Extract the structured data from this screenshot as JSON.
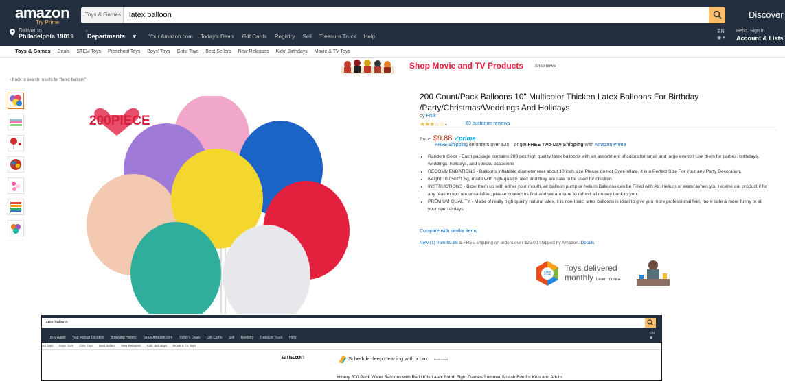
{
  "header": {
    "logo": "amazon",
    "logo_sub": "Try Prime",
    "search_category": "Toys & Games",
    "search_query": "latex balloon",
    "discover": "Discover s",
    "deliver_label": "Deliver to",
    "deliver_location": "Philadelphia 19019",
    "departments": "Departments",
    "nav": [
      "Your Amazon.com",
      "Today's Deals",
      "Gift Cards",
      "Registry",
      "Sell",
      "Treasure Truck",
      "Help"
    ],
    "lang": "EN",
    "account_hello": "Hello. Sign in",
    "account_lists": "Account & Lists"
  },
  "subnav": [
    "Toys & Games",
    "Deals",
    "STEM Toys",
    "Preschool Toys",
    "Boys' Toys",
    "Girls' Toys",
    "Best Sellers",
    "New Releases",
    "Kids' Birthdays",
    "Movie & TV Toys"
  ],
  "banner": {
    "text": "Shop Movie and TV Products",
    "shop_now": "Shop now"
  },
  "back_link": "Back to search results for \"latex balloon\"",
  "image_badge": "200PIECE",
  "product": {
    "title": "200 Count/Pack Balloons 10\" Multicolor Thicken Latex Balloons For Birthday /Party/Christmas/Weddings And Holidays",
    "by_label": "by",
    "brand": "Pruk",
    "stars": "★★★☆☆",
    "rating_value": 3,
    "reviews": "83 customer reviews",
    "price_label": "Price:",
    "price": "$9.88",
    "prime": "prime",
    "shipping_free": "FREE Shipping",
    "shipping_text": "on orders over $25—or get",
    "shipping_bold": "FREE Two-Day Shipping",
    "shipping_with": "with",
    "amazon_prime": "Amazon Prime",
    "bullets": [
      "Random Color - Each package contains 200 pcs high quality latex balloons with an assortment of colors,for small and large events! Use them for parties, birthdays, weddings, holidays, and special occasions",
      "RECOMMENDATIONS - Balloons inflatable diameter rear about 10 inch size,Please do not Over-inflate, it is a Perfect Size For Your any Party Decoration.",
      "weight : 0.05oz/1.5g, made with high-quality latex and they are safe to be used for children.",
      "INSTRUCTIONS - Blow them up with either your mouth, air balloon pump or helium.Balloons can be Filled with Air, Helium or Water.When you receive our product,if for any reason you are unsatisfied, please contact us first and we are sure to refund all money back to you.",
      "PREMIUM QUALITY - Made of really high quality natural latex, it is non-toxic. latex balloons is ideal to give you more professional feel, more safe & more funny to all your special days"
    ],
    "compare": "Compare with similar items",
    "new_link": "New (1) from $9.88",
    "new_text": "& FREE shipping on orders over $25.00 shipped by Amazon.",
    "details": "Details"
  },
  "club_ad": {
    "badge": "STEM CLUB",
    "line1": "Toys delivered",
    "line2": "monthly",
    "learn_more": "Learn more"
  },
  "inner": {
    "search": "latex balloon",
    "nav": [
      "Buy Again",
      "Your Pickup Location",
      "Browsing History",
      "Tara's Amazon.com",
      "Today's Deals",
      "Gift Cards",
      "Sell",
      "Registry",
      "Treasure Truck",
      "Help"
    ],
    "lang": "EN",
    "sub": [
      "ool Toys",
      "Boys' Toys",
      "Girls' Toys",
      "Best Sellers",
      "New Releases",
      "Kids' Birthdays",
      "Movie & TV Toys"
    ],
    "logo": "amazon",
    "ad_text": "Schedule deep cleaning with a pro",
    "book_now": "Book now",
    "title": "Hibery 500 Pack Water Balloons with Refill Kits Latex Bomb Fight Games-Summer Splash Fun for Kids and Adults"
  }
}
